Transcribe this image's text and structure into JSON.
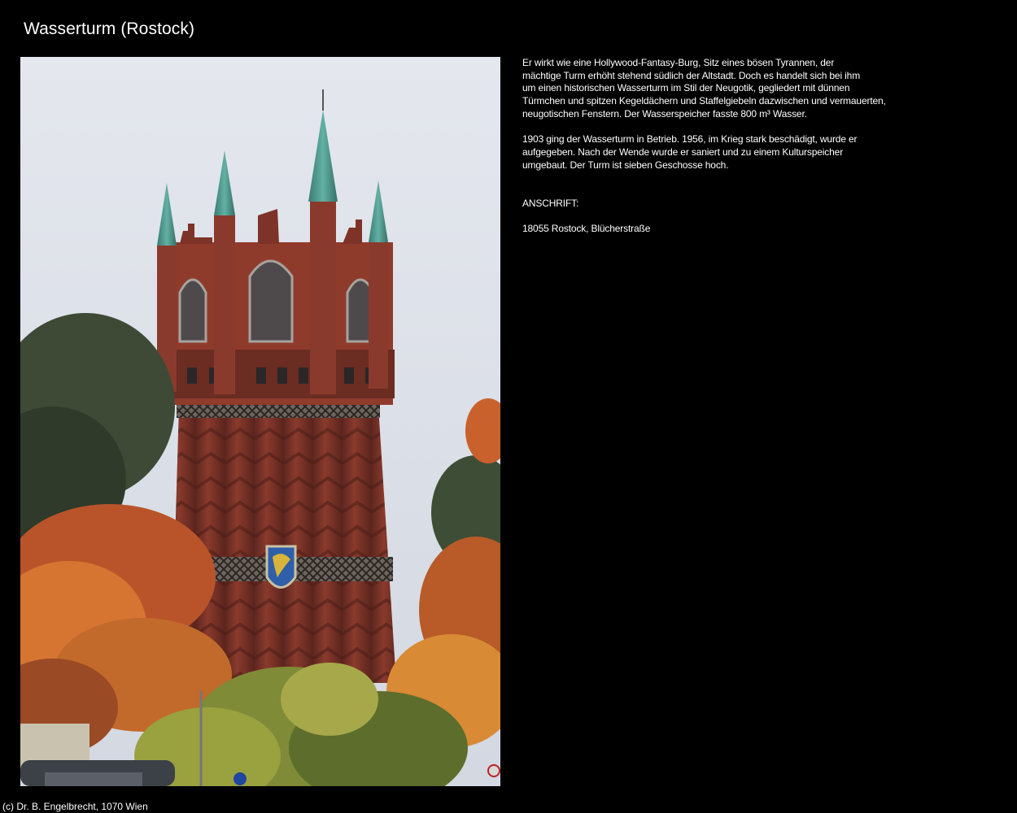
{
  "page": {
    "title": "Wasserturm (Rostock)"
  },
  "photo": {
    "subject": "water-tower-photo"
  },
  "description": {
    "paragraph_1": "Er wirkt wie eine Hollywood-Fantasy-Burg, Sitz eines bösen Tyrannen, der\nmächtige Turm erhöht stehend südlich der Altstadt. Doch es handelt sich bei ihm\num einen historischen Wasserturm im Stil der Neugotik, gegliedert mit dünnen\nTürmchen und spitzen Kegeldächern und Staffelgiebeln dazwischen und vermauerten,\nneugotischen Fenstern. Der Wasserspeicher fasste 800 m³ Wasser.",
    "paragraph_2": "1903 ging der Wasserturm in Betrieb. 1956, im Krieg stark beschädigt, wurde er\naufgegeben. Nach der Wende wurde er saniert und zu einem Kulturspeicher\numgebaut. Der Turm ist sieben Geschosse hoch.",
    "address_label": "ANSCHRIFT:",
    "address_value": "18055 Rostock, Blücherstraße"
  },
  "footer": {
    "copyright": "(c) Dr. B. Engelbrecht, 1070 Wien"
  },
  "colors": {
    "background": "#000000",
    "text": "#ffffff",
    "brick": "#8a3a2c",
    "copper_roof": "#4f9a8f",
    "sky": "#dfe3ea"
  }
}
